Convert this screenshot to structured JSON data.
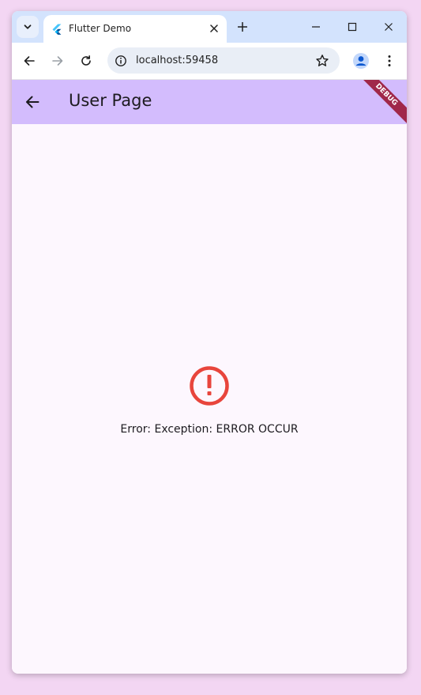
{
  "browser": {
    "tab": {
      "title": "Flutter Demo",
      "favicon": "flutter-icon"
    },
    "address_bar": {
      "url": "localhost:59458"
    },
    "window_controls": [
      "minimize",
      "maximize",
      "close"
    ]
  },
  "app": {
    "app_bar": {
      "title": "User Page",
      "background": "#d3bcfd",
      "debug_banner": "DEBUG"
    },
    "body": {
      "background": "#fdf7fe",
      "error_icon": "error-outline-icon",
      "error_color": "#e8453c",
      "error_message": "Error: Exception: ERROR OCCUR"
    }
  }
}
